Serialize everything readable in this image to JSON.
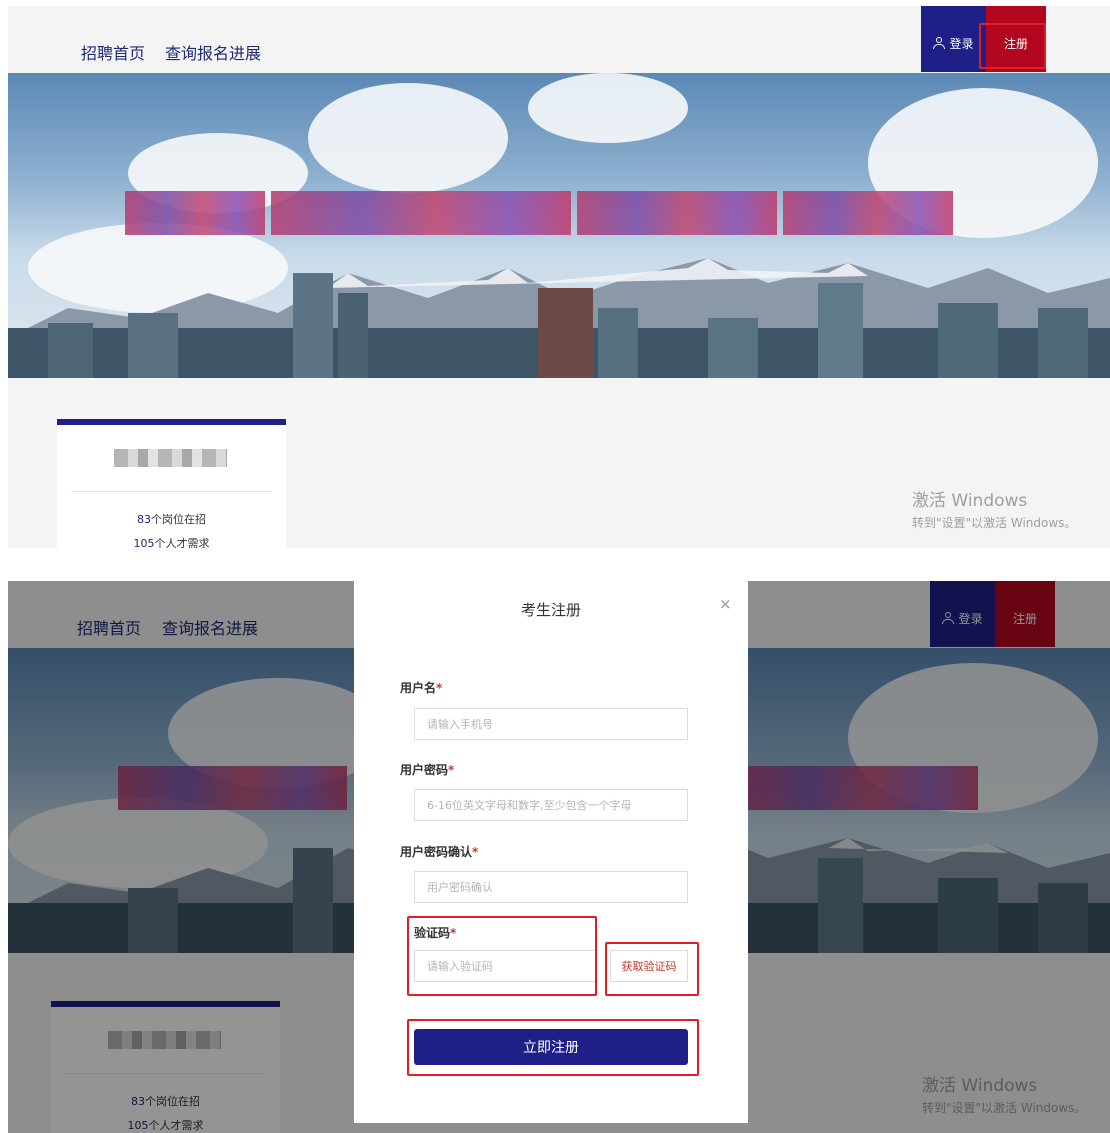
{
  "nav": {
    "home": "招聘首页",
    "progress": "查询报名进展"
  },
  "auth": {
    "login": "登录",
    "register": "注册"
  },
  "card": {
    "positions_count": "83",
    "positions_suffix": "个岗位在招",
    "talent_count": "105",
    "talent_suffix": "个人才需求"
  },
  "watermark": {
    "title": "激活 Windows",
    "subtitle": "转到\"设置\"以激活 Windows。"
  },
  "modal": {
    "title": "考生注册",
    "close": "×",
    "username_label": "用户名",
    "username_placeholder": "请输入手机号",
    "password_label": "用户密码",
    "password_placeholder": "6-16位英文字母和数字,至少包含一个字母",
    "confirm_label": "用户密码确认",
    "confirm_placeholder": "用户密码确认",
    "code_label": "验证码",
    "code_placeholder": "请输入验证码",
    "get_code_button": "获取验证码",
    "submit_button": "立即注册",
    "required_mark": "*"
  },
  "colors": {
    "brand_blue": "#1f1f88",
    "brand_red": "#b3071f",
    "highlight_red": "#e02020"
  }
}
